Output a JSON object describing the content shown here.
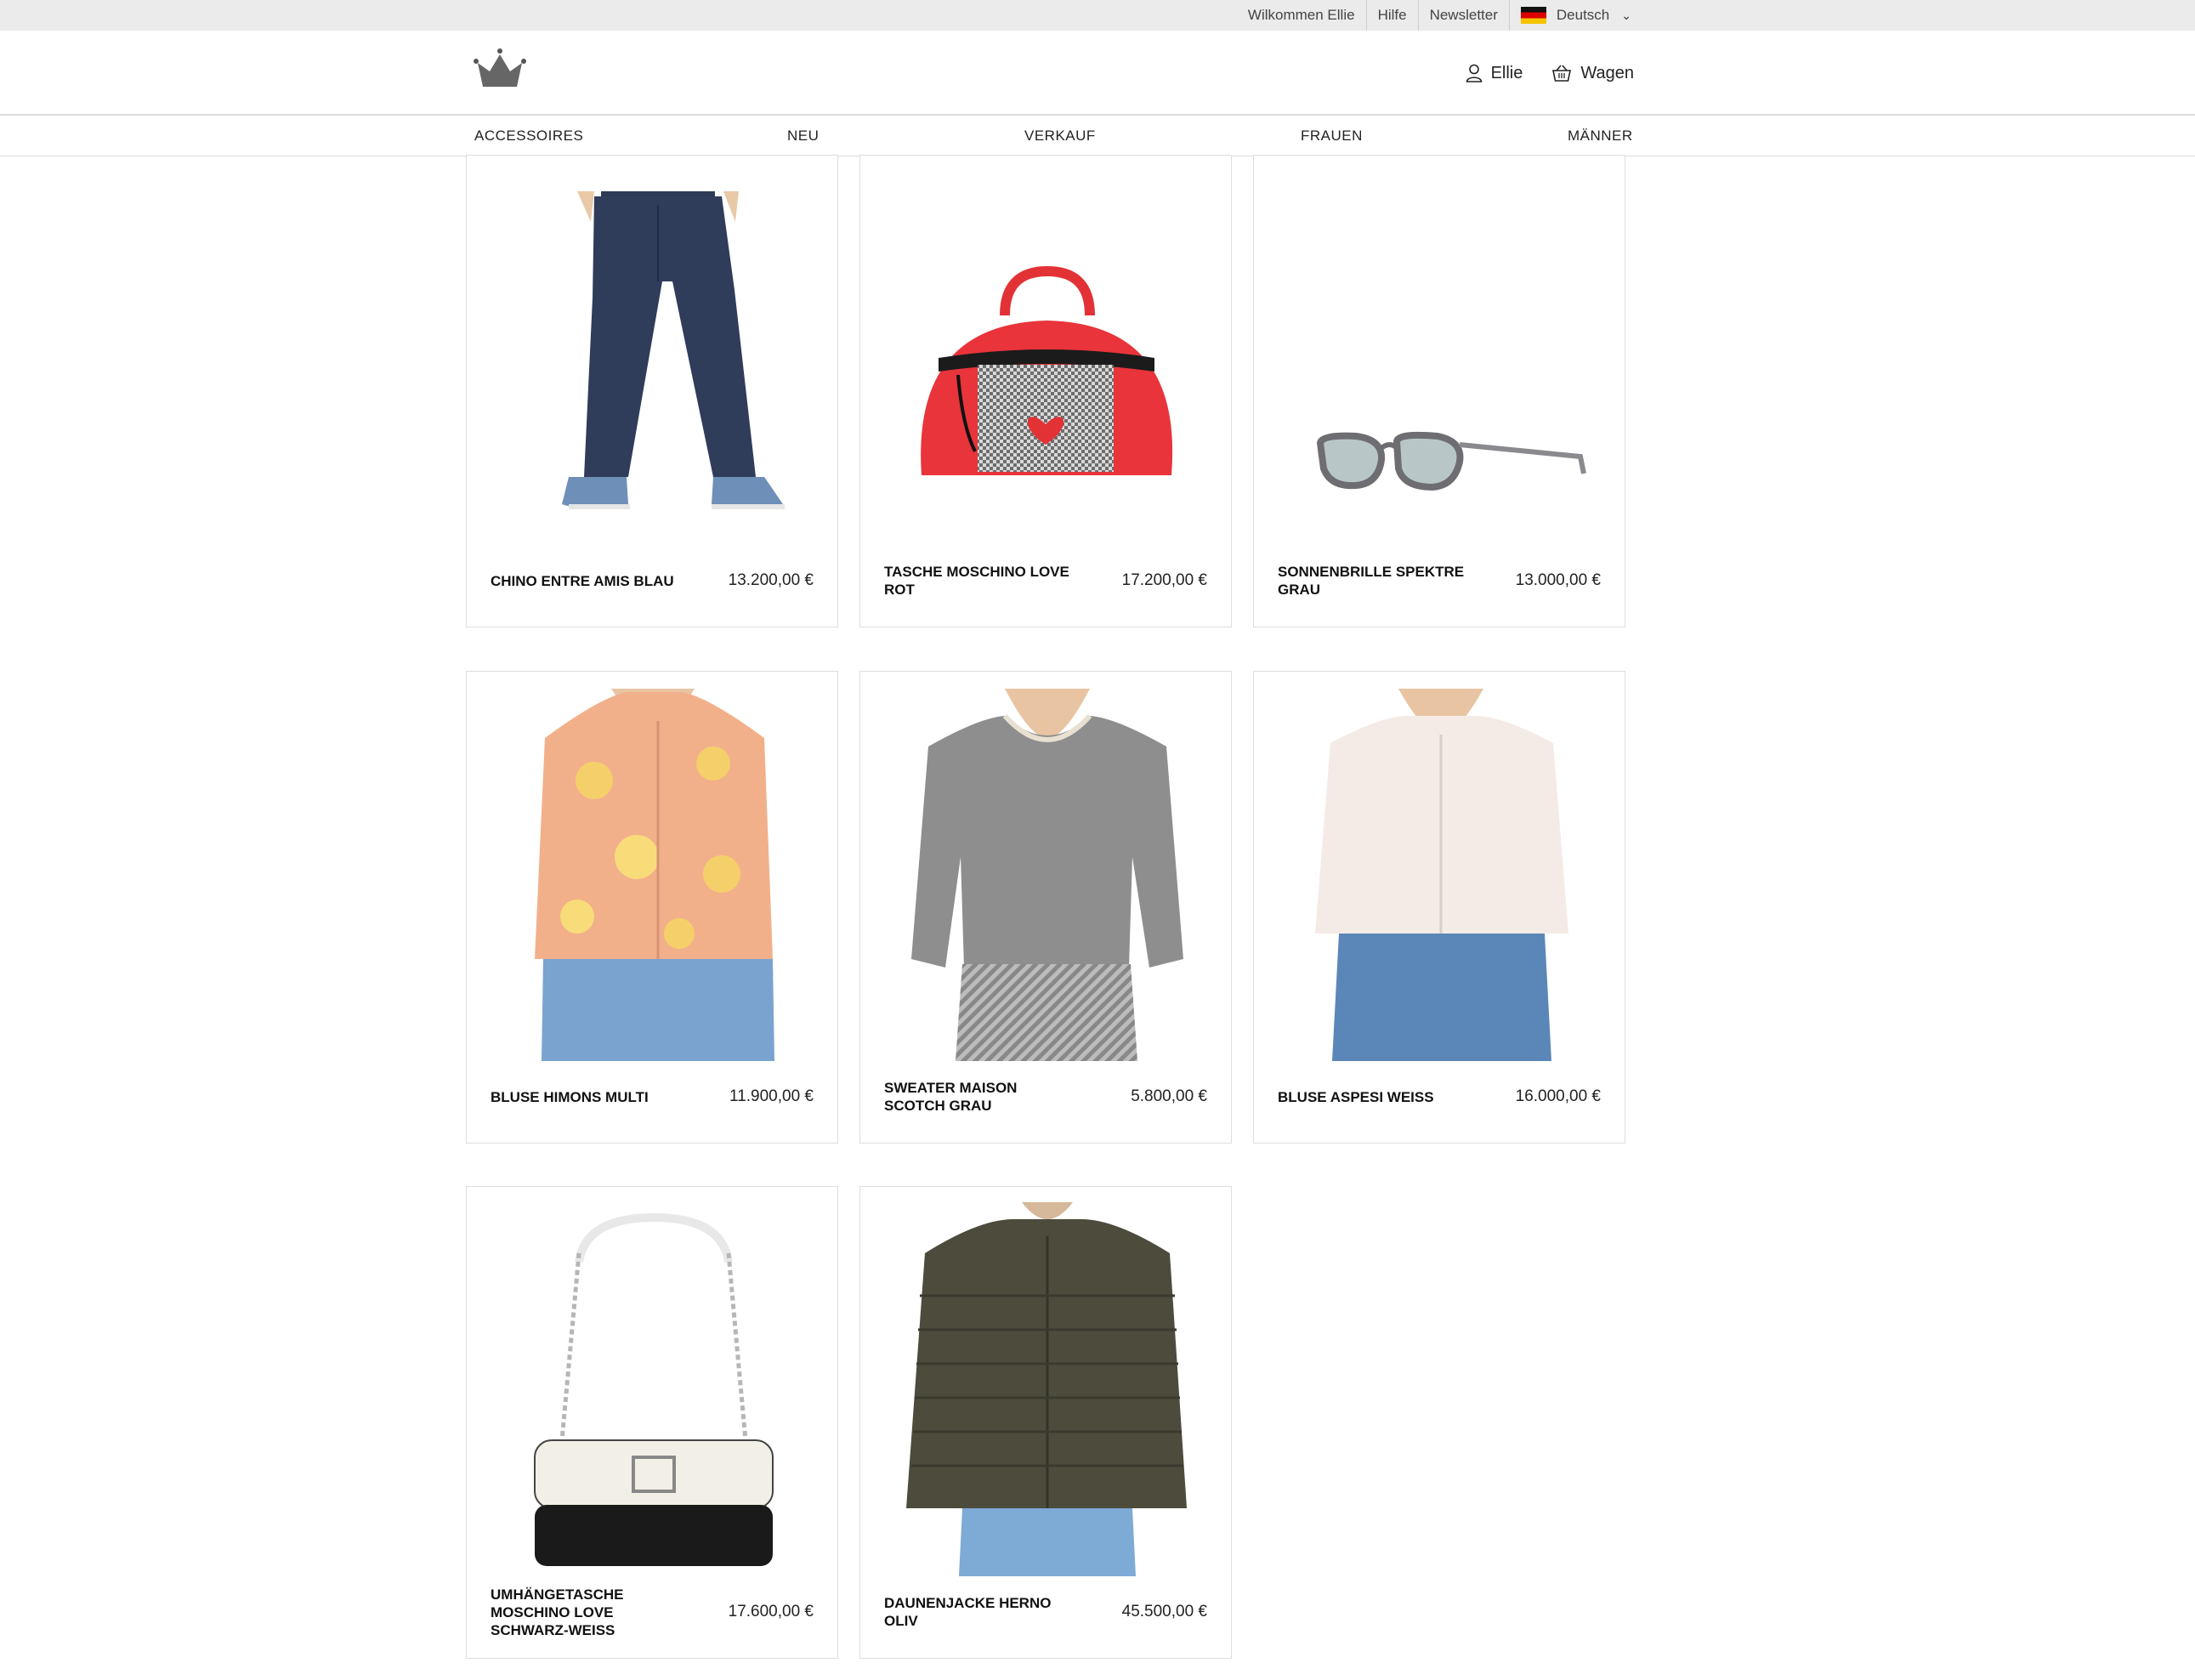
{
  "topbar": {
    "welcome": "Wilkommen Ellie",
    "help": "Hilfe",
    "newsletter": "Newsletter",
    "language": "Deutsch"
  },
  "header": {
    "user_label": "Ellie",
    "cart_label": "Wagen"
  },
  "nav": {
    "items": [
      "ACCESSOIRES",
      "NEU",
      "VERKAUF",
      "FRAUEN",
      "MÄNNER"
    ]
  },
  "products": [
    {
      "name": "CHINO ENTRE AMIS BLAU",
      "price": "13.200,00 €",
      "image": "navy-chino-pants"
    },
    {
      "name": "TASCHE MOSCHINO LOVE ROT",
      "price": "17.200,00 €",
      "image": "red-handbag"
    },
    {
      "name": "SONNENBRILLE SPEKTRE GRAU",
      "price": "13.000,00 €",
      "image": "grey-sunglasses"
    },
    {
      "name": "BLUSE HIMONS MULTI",
      "price": "11.900,00 €",
      "image": "floral-blouse"
    },
    {
      "name": "SWEATER MAISON SCOTCH GRAU",
      "price": "5.800,00 €",
      "image": "grey-sweater"
    },
    {
      "name": "BLUSE ASPESI WEISS",
      "price": "16.000,00 €",
      "image": "white-blouse"
    },
    {
      "name": "UMHÄNGETASCHE MOSCHINO LOVE SCHWARZ-WEISS",
      "price": "17.600,00 €",
      "image": "black-white-shoulder-bag"
    },
    {
      "name": "DAUNENJACKE HERNO OLIV",
      "price": "45.500,00 €",
      "image": "olive-down-jacket"
    }
  ]
}
